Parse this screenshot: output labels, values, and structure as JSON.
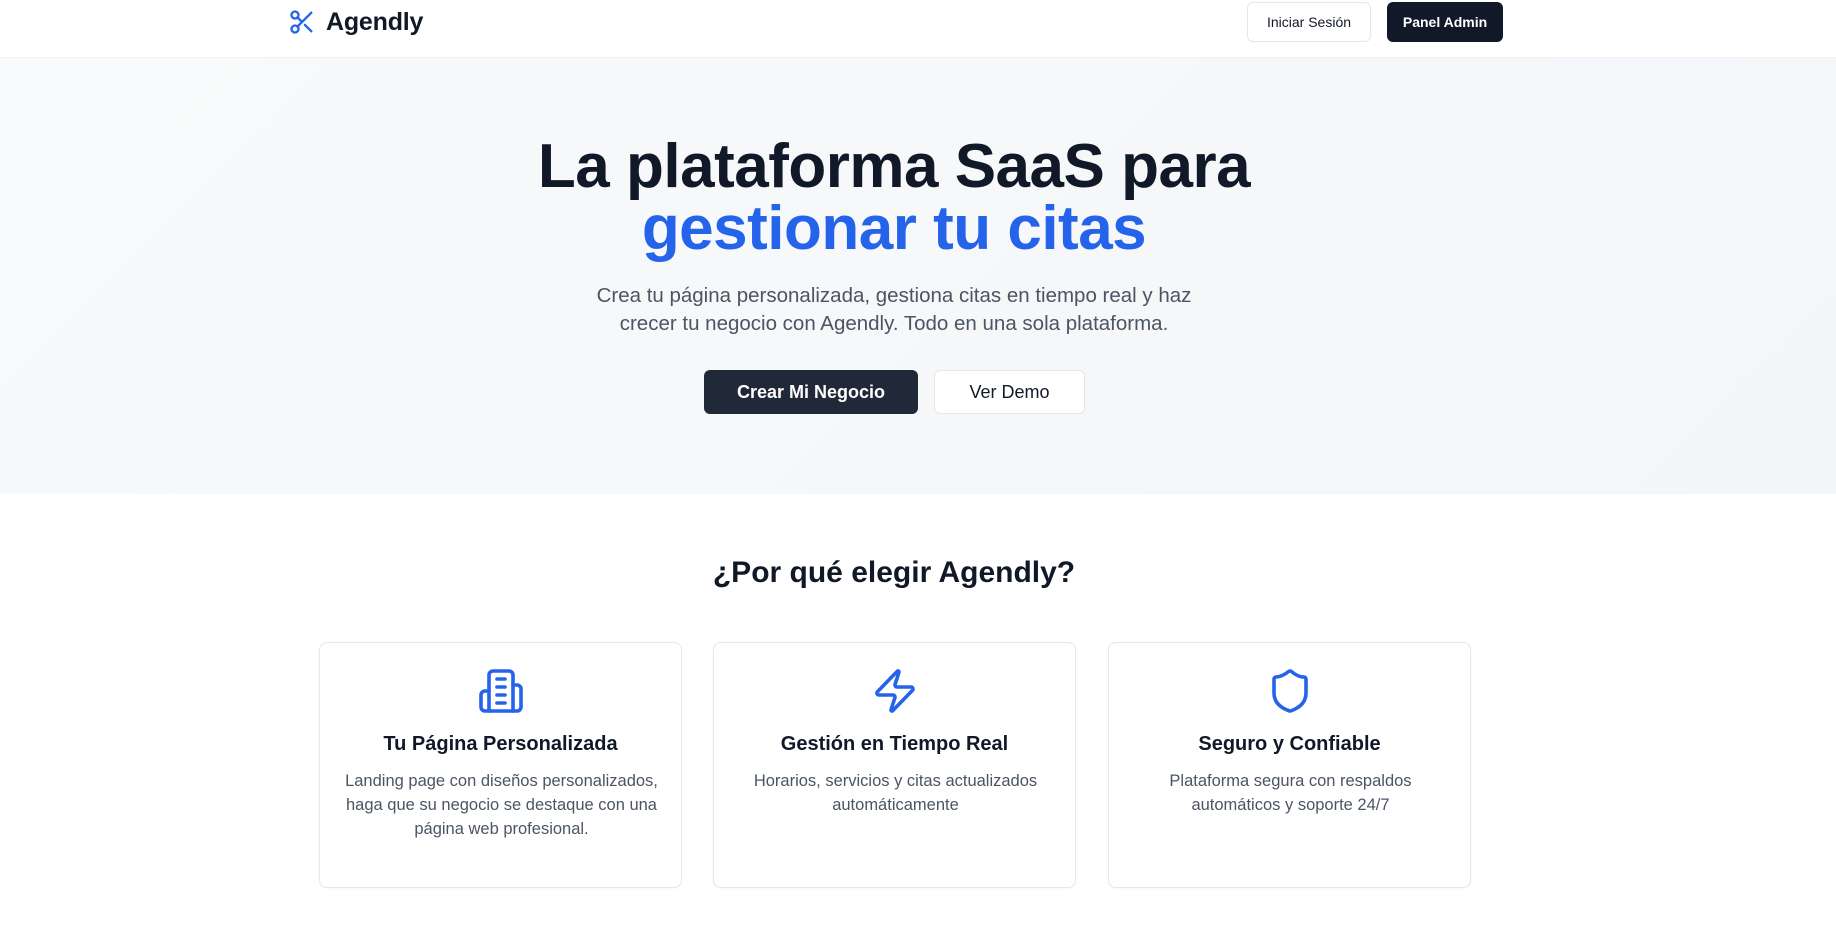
{
  "header": {
    "brand_name": "Agendly",
    "brand_icon": "scissors-icon",
    "login_label": "Iniciar Sesión",
    "admin_label": "Panel Admin"
  },
  "hero": {
    "title_line1": "La plataforma SaaS para",
    "title_line2": "gestionar tu citas",
    "subtitle": "Crea tu página personalizada, gestiona citas en tiempo real y haz crecer tu negocio con Agendly. Todo en una sola plataforma.",
    "primary_cta": "Crear Mi Negocio",
    "secondary_cta": "Ver Demo"
  },
  "features": {
    "title": "¿Por qué elegir Agendly?",
    "items": [
      {
        "icon": "building-icon",
        "title": "Tu Página Personalizada",
        "description": "Landing page con diseños personalizados, haga que su negocio se destaque con una página web profesional."
      },
      {
        "icon": "lightning-icon",
        "title": "Gestión en Tiempo Real",
        "description": "Horarios, servicios y citas actualizados automáticamente"
      },
      {
        "icon": "shield-icon",
        "title": "Seguro y Confiable",
        "description": "Plataforma segura con respaldos automáticos y soporte 24/7"
      }
    ]
  },
  "colors": {
    "accent": "#2563eb",
    "dark": "#111827",
    "text_muted": "#4b5563",
    "hero_bg": "#f5f7fa"
  }
}
